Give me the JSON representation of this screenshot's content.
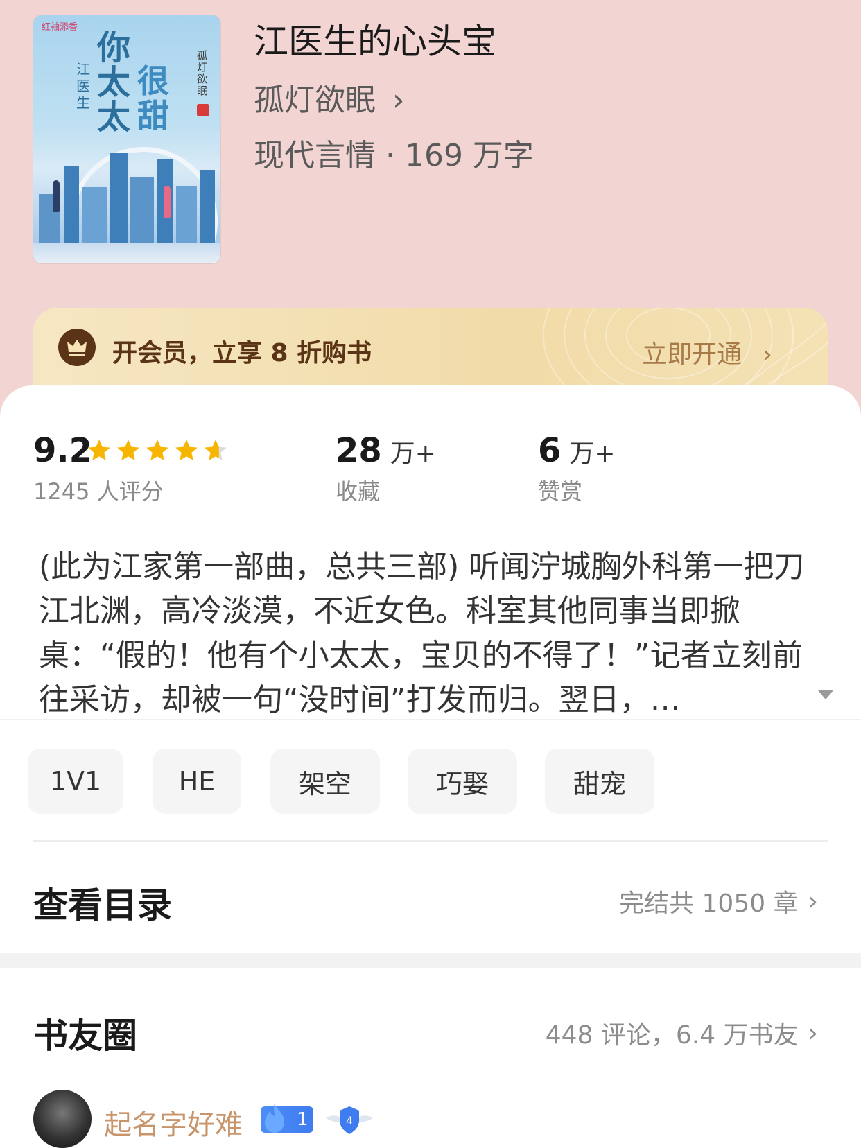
{
  "book": {
    "title": "江医生的心头宝",
    "author": "孤灯欲眠",
    "author_chevron": "›",
    "meta": "现代言情 · 169 万字",
    "cover": {
      "logo": "红袖添香",
      "title_line1": "你太太",
      "title_line2": "很甜",
      "subtitle": "江医生",
      "author": "孤灯欲眠"
    }
  },
  "vip": {
    "text": "开会员，立享 8 折购书",
    "action": "立即开通",
    "chevron": "›",
    "icon": "crown-icon",
    "color": "#5b3316"
  },
  "stats": {
    "rating": {
      "value": "9.2",
      "label": "1245 人评分",
      "stars": 4.6
    },
    "favorites": {
      "value": "28",
      "unit": "万+",
      "label": "收藏"
    },
    "tips": {
      "value": "6",
      "unit": "万+",
      "label": "赞赏"
    }
  },
  "description": "(此为江家第一部曲，总共三部) 听闻泞城胸外科第一把刀江北渊，高冷淡漠，不近女色。科室其他同事当即掀桌：“假的！他有个小太太，宝贝的不得了！”记者立刻前往采访，却被一句“没时间”打发而归。翌日，…",
  "tags": [
    "1V1",
    "HE",
    "架空",
    "巧娶",
    "甜宠"
  ],
  "catalog": {
    "title": "查看目录",
    "status": "完结共 1050 章",
    "chevron": "›"
  },
  "community": {
    "title": "书友圈",
    "summary": "448 评论，6.4 万书友",
    "chevron": "›",
    "first_post": {
      "username": "起名字好难",
      "fan_level": "1",
      "badge_level": "4"
    }
  },
  "colors": {
    "page_bg": "#f2d5d3",
    "star": "#f7b500",
    "username": "#c8956a",
    "level_badge": "#3f7cef"
  }
}
